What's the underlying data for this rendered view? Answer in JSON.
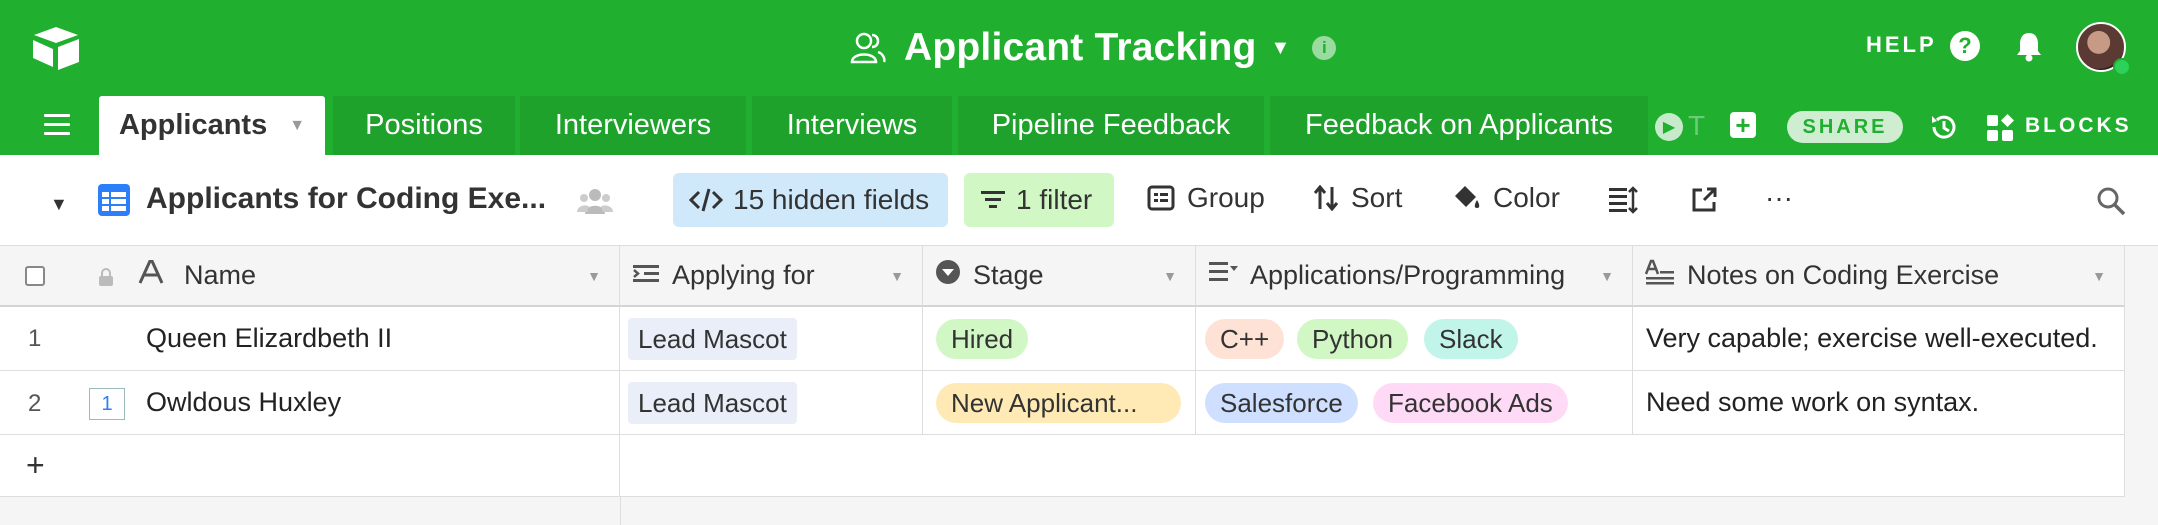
{
  "app": {
    "base_title": "Applicant Tracking",
    "help_label": "HELP",
    "help_icon_text": "?",
    "info_icon_text": "i",
    "share_label": "SHARE",
    "blocks_label": "BLOCKS",
    "brand_color": "#20af2e"
  },
  "tabs": [
    {
      "label": "Applicants",
      "active": true
    },
    {
      "label": "Positions"
    },
    {
      "label": "Interviewers"
    },
    {
      "label": "Interviews"
    },
    {
      "label": "Pipeline Feedback"
    },
    {
      "label": "Feedback on Applicants"
    }
  ],
  "tabs_overflow_text": "T",
  "view": {
    "name": "Applicants for Coding Exe...",
    "hidden_fields_label": "15 hidden fields",
    "filter_label": "1 filter",
    "group_label": "Group",
    "sort_label": "Sort",
    "color_label": "Color",
    "more_label": "···"
  },
  "columns": [
    {
      "label": "Name",
      "type": "primary-text"
    },
    {
      "label": "Applying for",
      "type": "linked-record"
    },
    {
      "label": "Stage",
      "type": "single-select"
    },
    {
      "label": "Applications/Programming",
      "type": "multi-select"
    },
    {
      "label": "Notes on Coding Exercise",
      "type": "long-text"
    }
  ],
  "rows": [
    {
      "num": "1",
      "name": "Queen Elizardbeth II",
      "applying_for": "Lead Mascot",
      "stage": {
        "label": "Hired",
        "color": "#d1f7c4"
      },
      "skills": [
        {
          "label": "C++",
          "color": "#fee2d5"
        },
        {
          "label": "Python",
          "color": "#d1f7c4"
        },
        {
          "label": "Slack",
          "color": "#c2f5e9"
        }
      ],
      "notes": "Very capable; exercise well-executed."
    },
    {
      "num": "2",
      "comment_count": "1",
      "name": "Owldous Huxley",
      "applying_for": "Lead Mascot",
      "stage": {
        "label": "New Applicant...",
        "color": "#ffeab6"
      },
      "skills": [
        {
          "label": "Salesforce",
          "color": "#cfdfff"
        },
        {
          "label": "Facebook Ads",
          "color": "#ffdaf6"
        }
      ],
      "notes": "Need some work on syntax."
    }
  ],
  "add_row_label": "+"
}
